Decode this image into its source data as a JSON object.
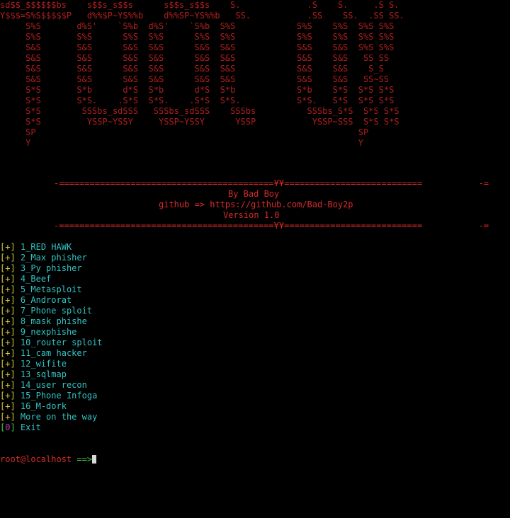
{
  "banner": {
    "lines": [
      "sd$$_$$$$$$bs    s$$s_s$$s      s$$s_s$$s    S.             .S    S.     .S S.",
      "Y$$$=S%S$$$$$P   d%%$P~YS%%b    d%%SP~YS%%b   SS.           .SS    SS.  .SS SS.",
      "     S%S       d%S'    `S%b  d%S'    `S%b  S%S            S%S    S%S  S%S S%S",
      "     S%S       S%S      S%S  S%S      S%S  S%S            S%S    S%S  S%S S%S",
      "     S&S       S&S      S&S  S&S      S&S  S&S            S&S    S&S  S%S S%S",
      "     S&S       S&S      S&S  S&S      S&S  S&S            S&S    S&S   SS SS",
      "     S&S       S&S      S&S  S&S      S&S  S&S            S&S    S&S    S_S",
      "     S&S       S&S      S&S  S&S      S&S  S&S            S&S    S&S   SS~SS",
      "     S*S       S*b      d*S  S*b      d*S  S*b            S*b    S*S  S*S S*S",
      "     S*S       S*S.    .S*S  S*S.    .S*S  S*S.           S*S.   S*S  S*S S*S",
      "     S*S        SSSbs_sdSSS   SSSbs_sdSSS    SSSbs          SSSbs_S*S  S*S S*S",
      "     S*S         YSSP~YSSY     YSSP~YSSY      YSSP           YSSP~SSS  S*S S*S",
      "     SP                                                               SP",
      "     Y                                                                Y"
    ]
  },
  "divider": {
    "top": "-==========================================¥¥===========================           -=",
    "bottom": "-==========================================¥¥===========================           -="
  },
  "credits": {
    "author": "By Bad Boy",
    "github": "github => https://github.com/Bad-Boy2p",
    "version": "Version 1.0"
  },
  "menu": {
    "items": [
      {
        "bracket": "[+]",
        "label": "1_RED HAWK"
      },
      {
        "bracket": "[+]",
        "label": "2_Max phisher"
      },
      {
        "bracket": "[+]",
        "label": "3_Py phisher"
      },
      {
        "bracket": "[+]",
        "label": "4_Beef"
      },
      {
        "bracket": "[+]",
        "label": "5_Metasploit"
      },
      {
        "bracket": "[+]",
        "label": "6_Androrat"
      },
      {
        "bracket": "[+]",
        "label": "7_Phone sploit"
      },
      {
        "bracket": "[+]",
        "label": "8_mask phishe"
      },
      {
        "bracket": "[+]",
        "label": "9_nexphishe"
      },
      {
        "bracket": "[+]",
        "label": "10_router sploit"
      },
      {
        "bracket": "[+]",
        "label": "11_cam hacker"
      },
      {
        "bracket": "[+]",
        "label": "12_wifite"
      },
      {
        "bracket": "[+]",
        "label": "13_sqlmap"
      },
      {
        "bracket": "[+]",
        "label": "14_user recon"
      },
      {
        "bracket": "[+]",
        "label": "15_Phone Infoga"
      },
      {
        "bracket": "[+]",
        "label": "16_M-dork"
      },
      {
        "bracket": "[+]",
        "label": "More on the way"
      }
    ],
    "exit": {
      "bracket_open": "[",
      "number": "0",
      "bracket_close": "]",
      "label": "Exit"
    }
  },
  "prompt": {
    "user_host": "root@localhost",
    "arrow": "==>"
  },
  "colors": {
    "background": "#000000",
    "banner": "#d62a2a",
    "bracket": "#d6c63a",
    "menu_text": "#33c3c3",
    "prompt_user": "#d62a2a",
    "prompt_arrow": "#44cc44"
  }
}
